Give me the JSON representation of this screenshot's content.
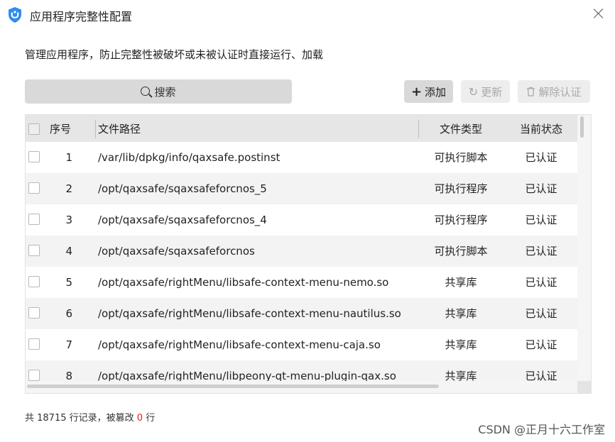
{
  "window": {
    "title": "应用程序完整性配置"
  },
  "description": "管理应用程序，防止完整性被破坏或未被认证时直接运行、加载",
  "search": {
    "label": "搜索"
  },
  "toolbar": {
    "add": "添加",
    "update": "更新",
    "deauth": "解除认证"
  },
  "table": {
    "headers": {
      "index": "序号",
      "path": "文件路径",
      "type": "文件类型",
      "status": "当前状态"
    },
    "rows": [
      {
        "index": "1",
        "path": "/var/lib/dpkg/info/qaxsafe.postinst",
        "type": "可执行脚本",
        "status": "已认证"
      },
      {
        "index": "2",
        "path": "/opt/qaxsafe/sqaxsafeforcnos_5",
        "type": "可执行程序",
        "status": "已认证"
      },
      {
        "index": "3",
        "path": "/opt/qaxsafe/sqaxsafeforcnos_4",
        "type": "可执行程序",
        "status": "已认证"
      },
      {
        "index": "4",
        "path": "/opt/qaxsafe/sqaxsafeforcnos",
        "type": "可执行脚本",
        "status": "已认证"
      },
      {
        "index": "5",
        "path": "/opt/qaxsafe/rightMenu/libsafe-context-menu-nemo.so",
        "type": "共享库",
        "status": "已认证"
      },
      {
        "index": "6",
        "path": "/opt/qaxsafe/rightMenu/libsafe-context-menu-nautilus.so",
        "type": "共享库",
        "status": "已认证"
      },
      {
        "index": "7",
        "path": "/opt/qaxsafe/rightMenu/libsafe-context-menu-caja.so",
        "type": "共享库",
        "status": "已认证"
      },
      {
        "index": "8",
        "path": "/opt/qaxsafe/rightMenu/libpeony-qt-menu-plugin-qax.so",
        "type": "共享库",
        "status": "已认证"
      }
    ]
  },
  "footer": {
    "prefix": "共 18715 行记录，被篡改",
    "tampered": "0",
    "suffix": "行"
  },
  "watermark": "CSDN @正月十六工作室",
  "colors": {
    "accent": "#2f8cf0",
    "tampered": "#e02020"
  }
}
